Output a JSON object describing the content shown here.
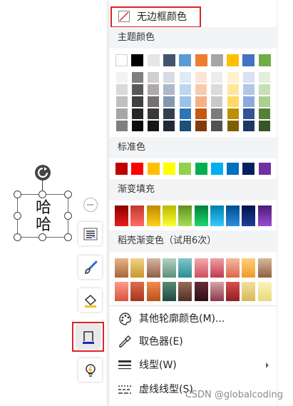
{
  "textbox_text": "哈\n哈",
  "textbox_line1": "哈",
  "textbox_line2": "哈",
  "menu": {
    "no_border_label": "无边框颜色",
    "theme_colors_label": "主题颜色",
    "standard_colors_label": "标准色",
    "gradient_fill_label": "渐变填充",
    "daoke_gradient_label": "稻壳渐变色（试用6次）",
    "more_colors_label": "其他轮廓颜色(M)...",
    "eyedropper_label": "取色器(E)",
    "line_type_label": "线型(W)",
    "dash_type_label": "虚线线型(S)"
  },
  "watermark": "CSDN @globalcoding",
  "theme_colors": [
    "#ffffff",
    "#000000",
    "#e7e6e6",
    "#44546a",
    "#5b9bd5",
    "#ed7d31",
    "#a5a5a5",
    "#ffc000",
    "#4472c4",
    "#70ad47"
  ],
  "theme_shades": [
    [
      "#f2f2f2",
      "#d9d9d9",
      "#bfbfbf",
      "#a6a6a6",
      "#7f7f7f"
    ],
    [
      "#7f7f7f",
      "#595959",
      "#404040",
      "#262626",
      "#0d0d0d"
    ],
    [
      "#d0cece",
      "#aeaaaa",
      "#757171",
      "#3a3838",
      "#171616"
    ],
    [
      "#d6dce4",
      "#acb9ca",
      "#8497b0",
      "#333f4f",
      "#222a35"
    ],
    [
      "#ddebf7",
      "#bdd7ee",
      "#9bc2e6",
      "#2f75b5",
      "#1f4e78"
    ],
    [
      "#fce4d6",
      "#f8cbad",
      "#f4b084",
      "#c65911",
      "#833c0b"
    ],
    [
      "#ededed",
      "#dbdbdb",
      "#c9c9c9",
      "#7b7b7b",
      "#525252"
    ],
    [
      "#fff2cc",
      "#ffe699",
      "#ffd966",
      "#bf8f00",
      "#7f6000"
    ],
    [
      "#d9e1f2",
      "#b4c6e7",
      "#8ea9db",
      "#305496",
      "#203764"
    ],
    [
      "#e2efda",
      "#c6e0b4",
      "#a9d08e",
      "#548235",
      "#375623"
    ]
  ],
  "standard_colors": [
    "#c00000",
    "#ff0000",
    "#ffc000",
    "#ffff00",
    "#92d050",
    "#00b050",
    "#00b0f0",
    "#0070c0",
    "#002060",
    "#7030a0"
  ],
  "gradient_fills": [
    [
      "#8b0000",
      "#e81c1c"
    ],
    [
      "#c0392b",
      "#ff6b6b"
    ],
    [
      "#c08a00",
      "#ffd11a"
    ],
    [
      "#b8b800",
      "#ffff33"
    ],
    [
      "#5e8f1e",
      "#a6e05a"
    ],
    [
      "#00803a",
      "#22d66c"
    ],
    [
      "#007fa8",
      "#33ccff"
    ],
    [
      "#004d8c",
      "#2b8fe0"
    ],
    [
      "#00134d",
      "#1f3f99"
    ],
    [
      "#4b1a78",
      "#9a4ed1"
    ]
  ],
  "daoke_row1": [
    [
      "#e8b48a",
      "#a86638"
    ],
    [
      "#f2d28a",
      "#c9962b"
    ],
    [
      "#d9b6a0",
      "#8f5e45"
    ],
    [
      "#b6d2c4",
      "#5b8f78"
    ],
    [
      "#7fc7cc",
      "#2b8d94"
    ],
    [
      "#f4a9b0",
      "#cf4d5c"
    ],
    [
      "#f0a0a8",
      "#c0394a"
    ],
    [
      "#f6b8a0",
      "#d7694c"
    ],
    [
      "#ffd07a",
      "#f09b2a"
    ],
    [
      "#d7b79a",
      "#8f6240"
    ]
  ],
  "daoke_row2": [
    [
      "#ff9a8a",
      "#d9533e"
    ],
    [
      "#e06a4a",
      "#a53422"
    ],
    [
      "#f28a4a",
      "#b8531b"
    ],
    [
      "#5a8a7a",
      "#1f4a3f"
    ],
    [
      "#9a6a5a",
      "#4f2f25"
    ],
    [
      "#6a2a3a",
      "#2f0f18"
    ],
    [
      "#d9a0a8",
      "#8a3a4a"
    ],
    [
      "#d85050",
      "#8e1f1f"
    ],
    [
      "#f4e0a0",
      "#d7b95a"
    ],
    [
      "#fbf4b8",
      "#e8d97a"
    ]
  ],
  "colors": {
    "highlight": "#d8262b",
    "accent_blue": "#1a2bbf"
  }
}
